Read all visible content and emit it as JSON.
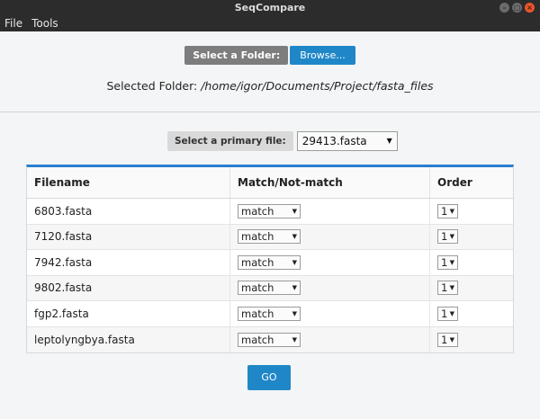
{
  "window": {
    "title": "SeqCompare",
    "min_icon": "–",
    "max_icon": "▢",
    "close_icon": "×"
  },
  "menu": {
    "items": [
      "File",
      "Tools"
    ]
  },
  "folder": {
    "label": "Select a Folder:",
    "browse_label": "Browse...",
    "selected_prefix": "Selected Folder: ",
    "selected_path": "/home/igor/Documents/Project/fasta_files"
  },
  "primary": {
    "label": "Select a primary file:",
    "value": "29413.fasta",
    "arrow": "▼"
  },
  "table": {
    "headers": [
      "Filename",
      "Match/Not-match",
      "Order"
    ],
    "rows": [
      {
        "filename": "6803.fasta",
        "match": "match",
        "order": "1"
      },
      {
        "filename": "7120.fasta",
        "match": "match",
        "order": "1"
      },
      {
        "filename": "7942.fasta",
        "match": "match",
        "order": "1"
      },
      {
        "filename": "9802.fasta",
        "match": "match",
        "order": "1"
      },
      {
        "filename": "fgp2.fasta",
        "match": "match",
        "order": "1"
      },
      {
        "filename": "leptolyngbya.fasta",
        "match": "match",
        "order": "1"
      }
    ],
    "arrow": "▼"
  },
  "go_label": "GO",
  "colors": {
    "accent": "#1f87c8",
    "titlebar": "#2c2c2c",
    "table_top": "#2a7fd0"
  }
}
